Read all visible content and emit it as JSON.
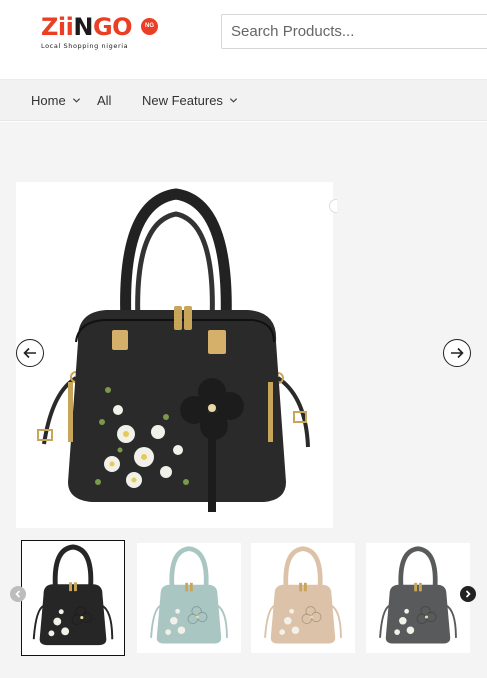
{
  "header": {
    "logo": {
      "part_z": "Z",
      "part_ii": "ii",
      "part_n": "N",
      "part_go": "GO",
      "badge": "NG",
      "tagline": "Local Shopping nigeria"
    },
    "search": {
      "placeholder": "Search Products...",
      "value": ""
    }
  },
  "nav": {
    "items": [
      {
        "label": "Home",
        "has_dropdown": true
      },
      {
        "label": "All",
        "has_dropdown": false
      },
      {
        "label": "New Features",
        "has_dropdown": true
      }
    ]
  },
  "product": {
    "main_image": {
      "icon": "handbag-black-floral",
      "bag_color": "#2a2a2a"
    },
    "carousel": {
      "prev_icon": "arrow-left-circle-icon",
      "next_icon": "arrow-right-circle-icon"
    },
    "thumbnails": [
      {
        "icon": "handbag-thumb",
        "bag_color": "#262626",
        "selected": true
      },
      {
        "icon": "handbag-thumb",
        "bag_color": "#a9c6c2",
        "selected": false
      },
      {
        "icon": "handbag-thumb",
        "bag_color": "#dcc2a8",
        "selected": false
      },
      {
        "icon": "handbag-thumb",
        "bag_color": "#585a5b",
        "selected": false
      }
    ]
  },
  "colors": {
    "brand": "#ea3f24",
    "nav_bg": "#f2f2f2",
    "content_bg": "#f4f4f4"
  }
}
